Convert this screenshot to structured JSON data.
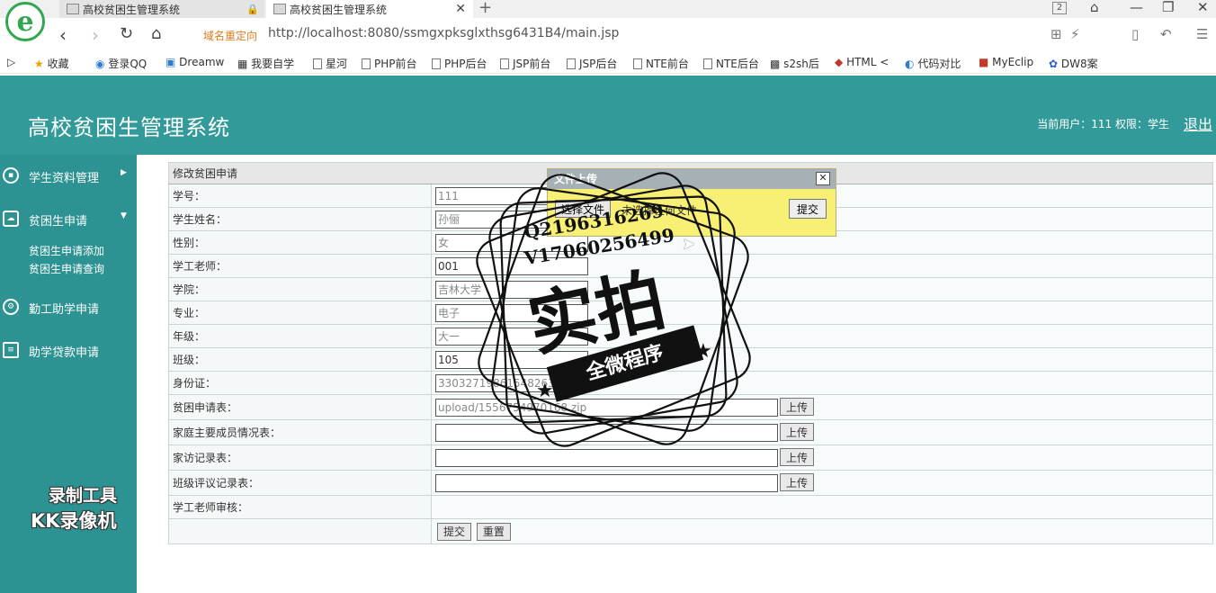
{
  "browser": {
    "logo_letter": "e",
    "tabs": [
      {
        "title": "高校贫困生管理系统"
      },
      {
        "title": "高校贫困生管理系统"
      }
    ],
    "tab_count": "2",
    "redirect_label": "域名重定向",
    "url": "http://localhost:8080/ssmgxpksglxthsg6431B4/main.jsp",
    "bookmarks": [
      "收藏",
      "登录QQ",
      "Dreamw",
      "我要自学",
      "星河",
      "PHP前台",
      "PHP后台",
      "JSP前台",
      "JSP后台",
      "NTE前台",
      "NTE后台",
      "s2sh后",
      "HTML <",
      "代码对比",
      "MyEclip",
      "DW8案"
    ]
  },
  "header": {
    "title": "高校贫困生管理系统",
    "user_info": "当前用户：111  权限：学生",
    "logout": "退出"
  },
  "sidebar": {
    "menus": [
      {
        "label": "学生资料管理"
      },
      {
        "label": "贫困生申请"
      },
      {
        "label": "勤工助学申请"
      },
      {
        "label": "助学贷款申请"
      }
    ],
    "submenu": [
      "贫困生申请添加",
      "贫困生申请查询"
    ]
  },
  "form": {
    "title": "修改贫困申请",
    "fields": [
      {
        "label": "学号：",
        "value": "111"
      },
      {
        "label": "学生姓名：",
        "value": "孙俪"
      },
      {
        "label": "性别：",
        "value": "女"
      },
      {
        "label": "学工老师：",
        "value": "001"
      },
      {
        "label": "学院：",
        "value": "吉林大学"
      },
      {
        "label": "专业：",
        "value": "电子"
      },
      {
        "label": "年级：",
        "value": "大一"
      },
      {
        "label": "班级：",
        "value": "105"
      },
      {
        "label": "身份证：",
        "value": "330327198615482633"
      }
    ],
    "uploads": [
      {
        "label": "贫困申请表：",
        "value": "upload/1556754970168.zip"
      },
      {
        "label": "家庭主要成员情况表：",
        "value": ""
      },
      {
        "label": "家访记录表：",
        "value": ""
      },
      {
        "label": "班级评议记录表：",
        "value": ""
      }
    ],
    "upload_btn": "上传",
    "review_label": "学工老师审核：",
    "submit": "提交",
    "reset": "重置"
  },
  "dialog": {
    "title": "文件上传",
    "close": "✕",
    "choose_file": "选择文件",
    "no_file": "未选择任何文件",
    "submit": "提交"
  },
  "watermark": {
    "stamp_q": "Q2196316269",
    "stamp_v": "V17060256499",
    "stamp_big": "实拍",
    "stamp_banner": "全微程序",
    "recorder_line1": "录制工具",
    "recorder_line2": "KK录像机"
  }
}
